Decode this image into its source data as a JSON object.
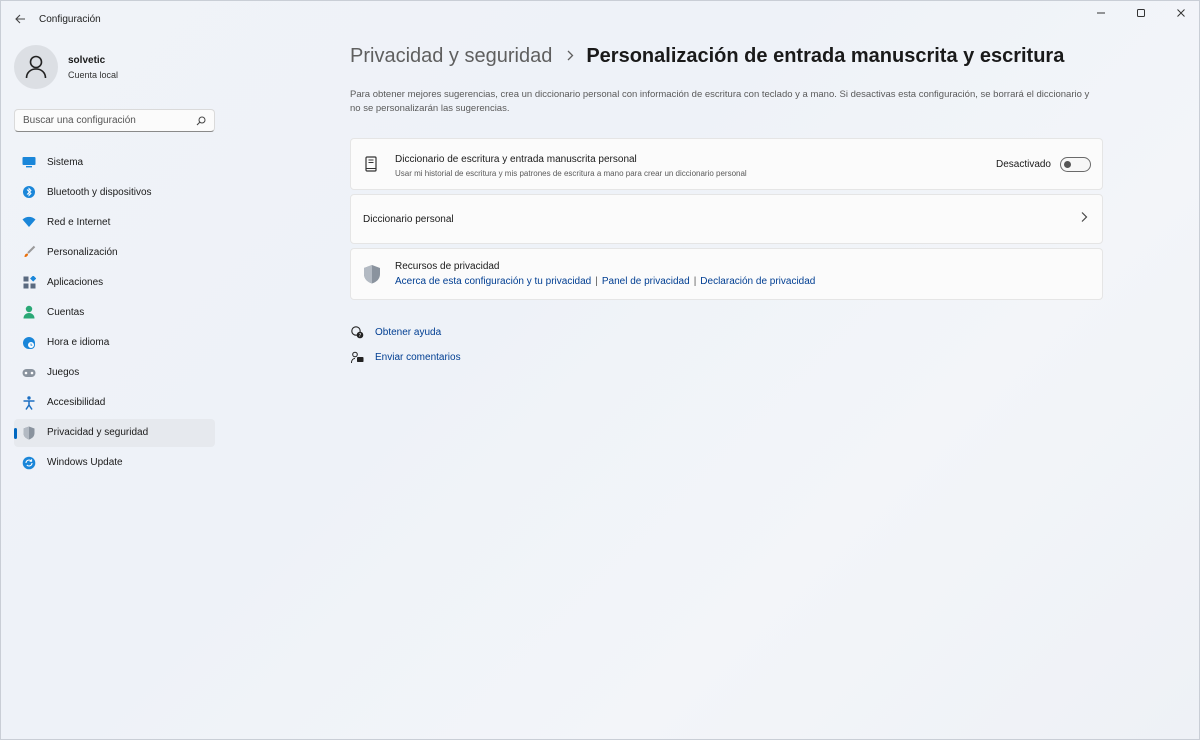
{
  "window": {
    "title": "Configuración"
  },
  "profile": {
    "name": "solvetic",
    "account_type": "Cuenta local"
  },
  "search": {
    "placeholder": "Buscar una configuración"
  },
  "sidebar": {
    "items": [
      {
        "label": "Sistema",
        "icon": "system-icon",
        "color": "#0078d4"
      },
      {
        "label": "Bluetooth y dispositivos",
        "icon": "bluetooth-icon",
        "color": "#0078d4"
      },
      {
        "label": "Red e Internet",
        "icon": "wifi-icon",
        "color": "#0078d4"
      },
      {
        "label": "Personalización",
        "icon": "brush-icon",
        "color": "#e8700d"
      },
      {
        "label": "Aplicaciones",
        "icon": "apps-icon",
        "color": "#5a6a80"
      },
      {
        "label": "Cuentas",
        "icon": "person-icon",
        "color": "#2aa876"
      },
      {
        "label": "Hora e idioma",
        "icon": "clock-globe-icon",
        "color": "#0078d4"
      },
      {
        "label": "Juegos",
        "icon": "gamepad-icon",
        "color": "#7a8390"
      },
      {
        "label": "Accesibilidad",
        "icon": "accessibility-icon",
        "color": "#1b6ec2"
      },
      {
        "label": "Privacidad y seguridad",
        "icon": "shield-icon",
        "color": "#7a8390",
        "active": true
      },
      {
        "label": "Windows Update",
        "icon": "update-icon",
        "color": "#0078d4"
      }
    ]
  },
  "breadcrumb": {
    "parent": "Privacidad y seguridad",
    "current": "Personalización de entrada manuscrita y escritura"
  },
  "description": "Para obtener mejores sugerencias, crea un diccionario personal con información de escritura con teclado y a mano. Si desactivas esta configuración, se borrará el diccionario y no se personalizarán las sugerencias.",
  "cards": {
    "dictionary_setting": {
      "title": "Diccionario de escritura y entrada manuscrita personal",
      "subtitle": "Usar mi historial de escritura y mis patrones de escritura a mano para crear un diccionario personal",
      "toggle_label": "Desactivado",
      "toggle_on": false
    },
    "personal_dictionary": {
      "title": "Diccionario personal"
    },
    "privacy_resources": {
      "title": "Recursos de privacidad",
      "links": [
        "Acerca de esta configuración y tu privacidad",
        "Panel de privacidad",
        "Declaración de privacidad"
      ],
      "separator": "|"
    }
  },
  "help": {
    "get_help": "Obtener ayuda",
    "send_feedback": "Enviar comentarios"
  },
  "colors": {
    "accent": "#0067c0",
    "link": "#003e92"
  }
}
